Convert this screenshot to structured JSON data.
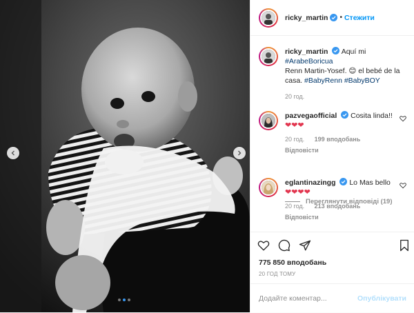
{
  "colors": {
    "accent": "#0095f6",
    "muted": "#8e8e8e",
    "heart": "#e2364f"
  },
  "header": {
    "username": "ricky_martin",
    "separator": "•",
    "follow_label": "Стежити"
  },
  "carousel": {
    "dot_count": 3,
    "active_index": 1
  },
  "caption": {
    "username": "ricky_martin",
    "text_1": "Aquí mi",
    "hashtag_1": "#ArabeBoricua",
    "text_2": "Renn Martin-Yosef.",
    "emoji": "😊",
    "text_3": "el bebé de la casa.",
    "hashtag_2": "#BabyRenn",
    "hashtag_3": "#BabyBOY",
    "time": "20 год."
  },
  "comments": [
    {
      "username": "pazvegaofficial",
      "text": "Cosita linda!!",
      "emoji": "❤❤❤",
      "time": "20 год.",
      "likes": "199 вподобань",
      "reply": "Відповісти"
    },
    {
      "username": "eglantinazingg",
      "text": "Lo Mas bello",
      "emoji": "❤❤❤❤",
      "time": "20 год.",
      "likes": "213 вподобань",
      "reply": "Відповісти"
    }
  ],
  "view_replies": "Переглянути відповіді (19)",
  "stats": {
    "likes": "775 850 вподобань",
    "time_ago": "20 ГОД ТОМУ"
  },
  "comment_box": {
    "placeholder": "Додайте коментар...",
    "publish_label": "Опублікувати"
  },
  "icons": [
    "heart-icon",
    "comment-icon",
    "share-icon",
    "bookmark-icon",
    "verified-icon",
    "chevron-left-icon",
    "chevron-right-icon"
  ]
}
